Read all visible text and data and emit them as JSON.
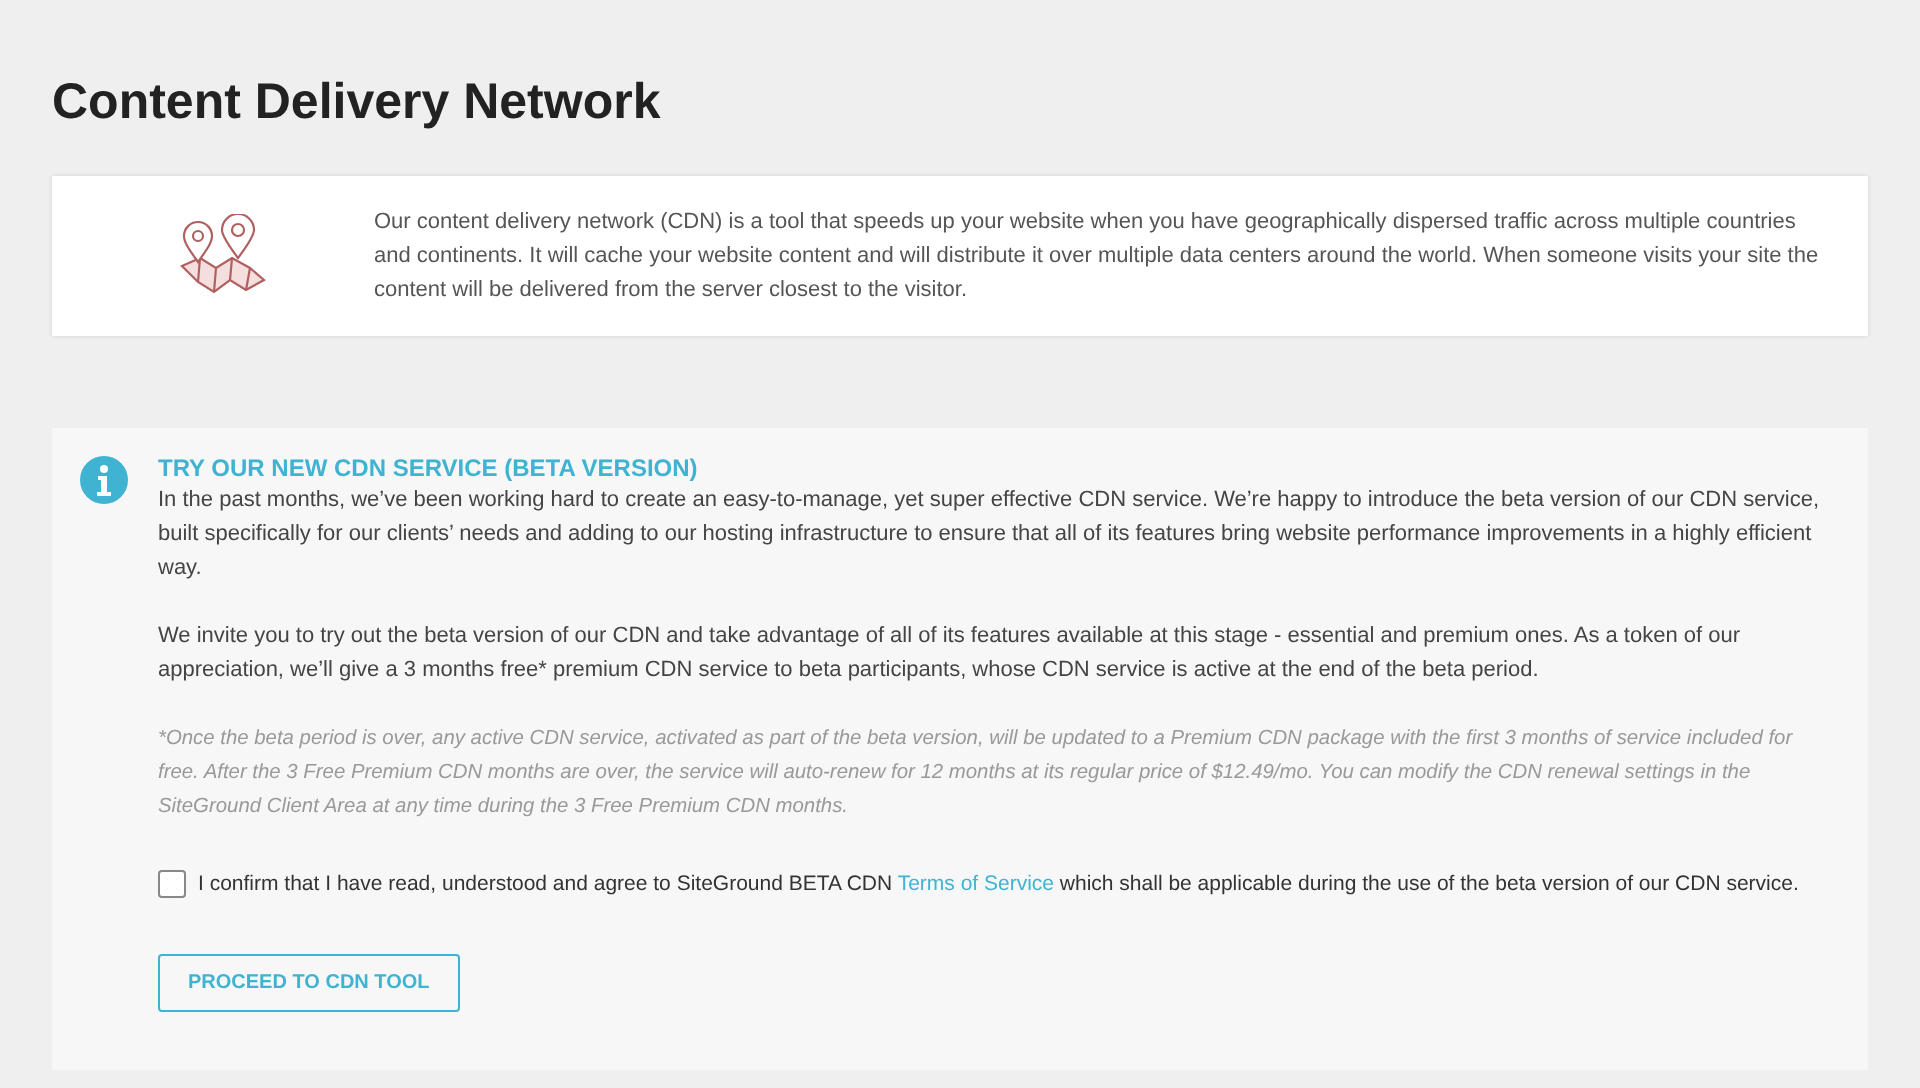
{
  "page": {
    "title": "Content Delivery Network"
  },
  "intro": {
    "text": "Our content delivery network (CDN) is a tool that speeds up your website when you have geographically dispersed traffic across multiple countries and continents. It will cache your website content and will distribute it over multiple data centers around the world. When someone visits your site the content will be delivered from the server closest to the visitor."
  },
  "beta": {
    "heading": "TRY OUR NEW CDN SERVICE (BETA VERSION)",
    "paragraphs": [
      "In the past months, we’ve been working hard to create an easy-to-manage, yet super effective CDN service. We’re happy to introduce the beta version of our CDN service, built specifically for our clients’ needs and adding to our hosting infrastructure to ensure that all of its features bring website performance improvements in a highly efficient way.",
      "We invite you to try out the beta version of our CDN and take advantage of all of its features available at this stage - essential and premium ones. As a token of our appreciation, we’ll give a 3 months free* premium CDN service to beta participants, whose CDN service is active at the end of the beta period."
    ],
    "footnote": "*Once the beta period is over, any active CDN service, activated as part of the beta version, will be updated to a Premium CDN package with the first 3 months of service included for free. After the 3 Free Premium CDN months are over, the service will auto-renew for 12 months at its regular price of $12.49/mo. You can modify the CDN renewal settings in the SiteGround Client Area at any time during the 3 Free Premium CDN months.",
    "confirm": {
      "checked": false,
      "text_before": "I confirm that I have read, understood and agree to SiteGround BETA CDN",
      "link": "Terms of Service",
      "text_after": "which shall be applicable during the use of the beta version of our CDN service."
    },
    "button": "PROCEED TO CDN TOOL"
  }
}
